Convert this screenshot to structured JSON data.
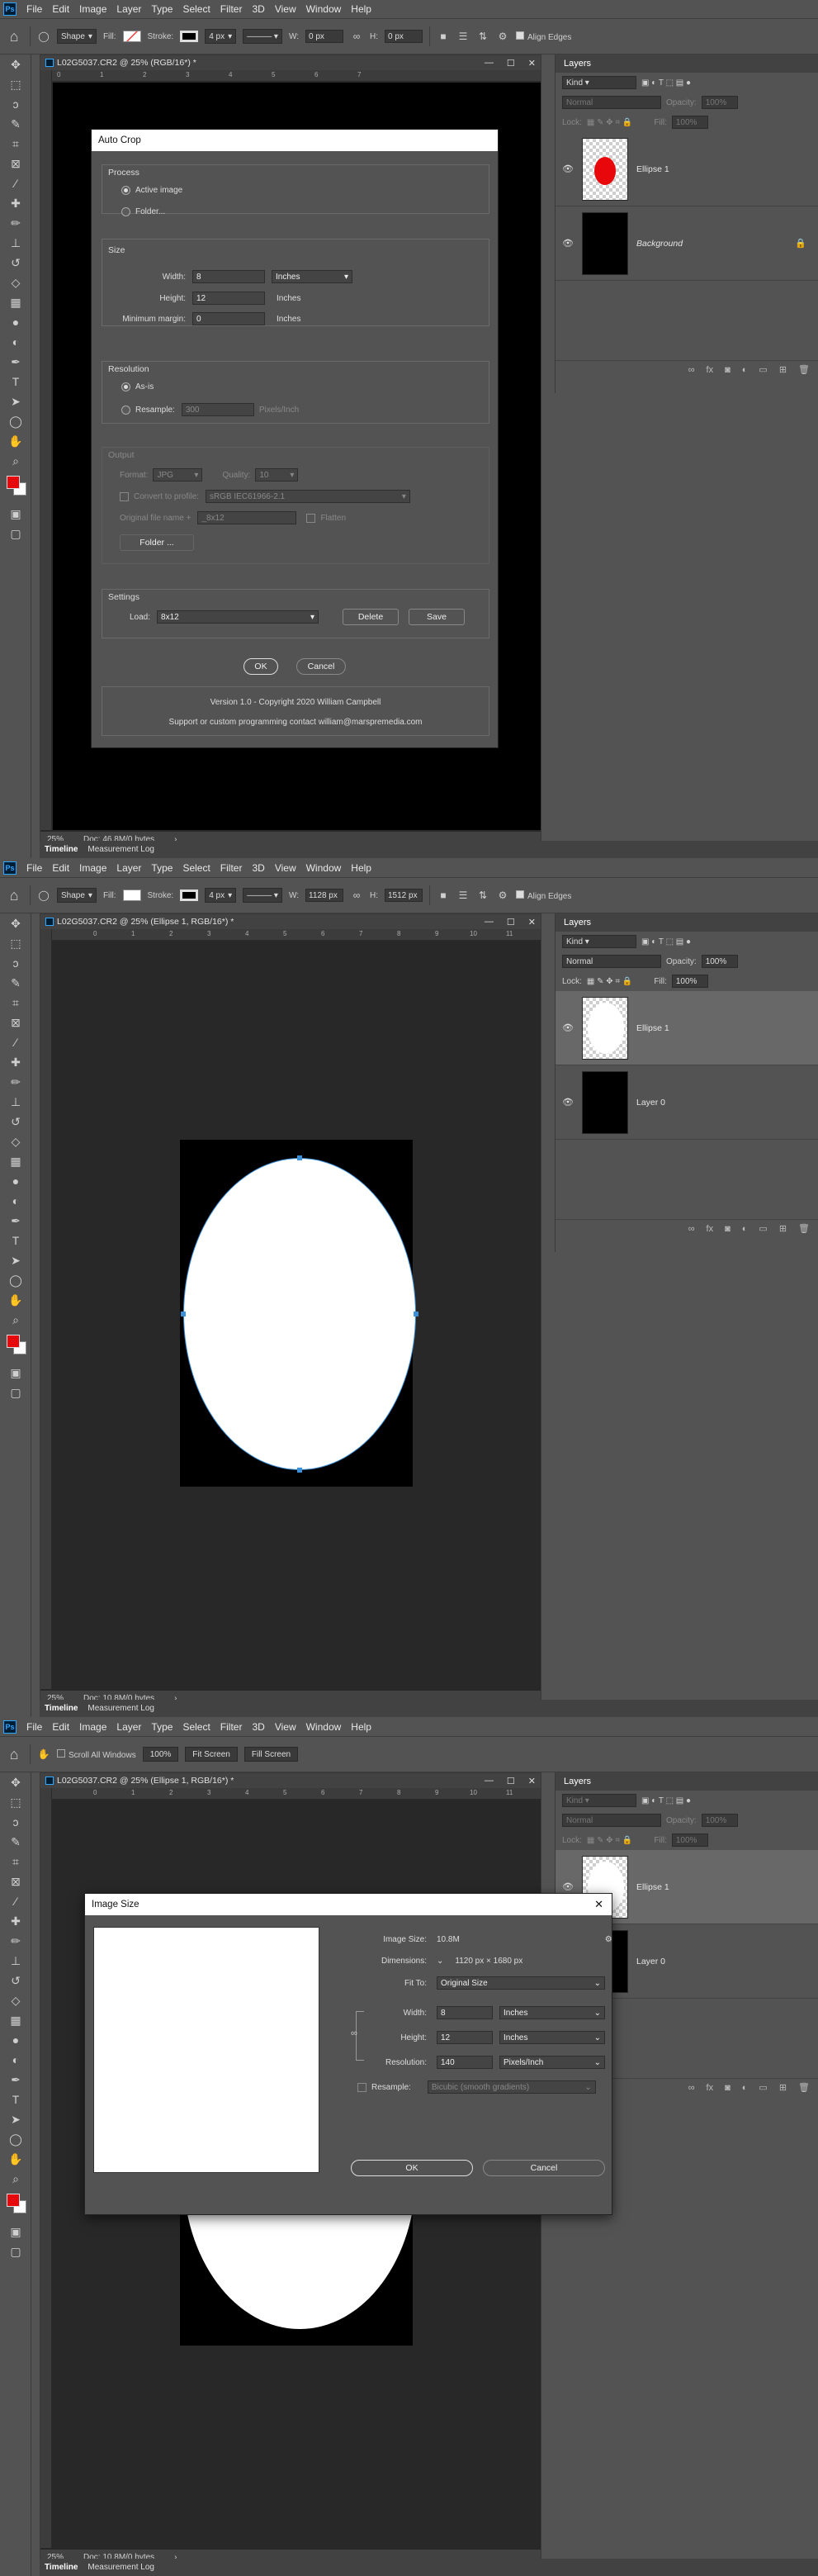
{
  "menus": [
    "File",
    "Edit",
    "Image",
    "Layer",
    "Type",
    "Select",
    "Filter",
    "3D",
    "View",
    "Window",
    "Help"
  ],
  "ps_logo": "Ps",
  "shot1": {
    "options": {
      "mode": "Shape",
      "fill_label": "Fill:",
      "stroke_label": "Stroke:",
      "stroke_width": "4 px",
      "w_label": "W:",
      "w_value": "0 px",
      "h_label": "H:",
      "h_value": "0 px",
      "align_edges": "Align Edges"
    },
    "doc_title": "L02G5037.CR2 @ 25% (RGB/16*) *",
    "ruler_h": [
      "0",
      "1",
      "2",
      "3",
      "4",
      "5",
      "6",
      "7"
    ],
    "status_zoom": "25%",
    "status_doc": "Doc: 46.8M/0 bytes",
    "dialog": {
      "title": "Auto Crop",
      "process": {
        "label": "Process",
        "active_image": "Active image",
        "folder": "Folder..."
      },
      "size": {
        "label": "Size",
        "width_label": "Width:",
        "width_value": "8",
        "width_unit": "Inches",
        "height_label": "Height:",
        "height_value": "12",
        "height_unit": "Inches",
        "margin_label": "Minimum margin:",
        "margin_value": "0",
        "margin_unit": "Inches"
      },
      "resolution": {
        "label": "Resolution",
        "as_is": "As-is",
        "resample": "Resample:",
        "resample_value": "300",
        "resample_unit": "Pixels/Inch"
      },
      "output": {
        "label": "Output",
        "format_label": "Format:",
        "format_value": "JPG",
        "quality_label": "Quality:",
        "quality_value": "10",
        "convert": "Convert to profile:",
        "profile_value": "sRGB IEC61966-2.1",
        "orig_label": "Original file name +",
        "orig_value": "_8x12",
        "flatten": "Flatten",
        "folder_btn": "Folder ..."
      },
      "settings": {
        "label": "Settings",
        "load_label": "Load:",
        "load_value": "8x12",
        "delete": "Delete",
        "save": "Save"
      },
      "ok": "OK",
      "cancel": "Cancel",
      "version": "Version 1.0 - Copyright 2020 William Campbell",
      "support": "Support or custom programming contact william@marspremedia.com"
    },
    "layers": [
      {
        "name": "Ellipse 1",
        "italic": false
      },
      {
        "name": "Background",
        "italic": true
      }
    ]
  },
  "shot2": {
    "options": {
      "mode": "Shape",
      "fill_label": "Fill:",
      "stroke_label": "Stroke:",
      "stroke_width": "4 px",
      "w_label": "W:",
      "w_value": "1128 px",
      "h_label": "H:",
      "h_value": "1512 px",
      "align_edges": "Align Edges"
    },
    "doc_title": "L02G5037.CR2 @ 25% (Ellipse 1, RGB/16*) *",
    "ruler_h": [
      "0",
      "1",
      "2",
      "3",
      "4",
      "5",
      "6",
      "7",
      "8",
      "9",
      "10",
      "11"
    ],
    "status_zoom": "25%",
    "status_doc": "Doc: 10.8M/0 bytes",
    "layers": [
      {
        "name": "Ellipse 1",
        "italic": false
      },
      {
        "name": "Layer 0",
        "italic": false
      }
    ]
  },
  "shot3": {
    "options": {
      "scroll_all": "Scroll All Windows",
      "zoom": "100%",
      "fit_screen": "Fit Screen",
      "fill_screen": "Fill Screen"
    },
    "doc_title": "L02G5037.CR2 @ 25% (Ellipse 1, RGB/16*) *",
    "ruler_h": [
      "0",
      "1",
      "2",
      "3",
      "4",
      "5",
      "6",
      "7",
      "8",
      "9",
      "10",
      "11"
    ],
    "status_zoom": "25%",
    "status_doc": "Doc: 10.8M/0 bytes",
    "dialog": {
      "title": "Image Size",
      "image_size_label": "Image Size:",
      "image_size_value": "10.8M",
      "dimensions_label": "Dimensions:",
      "dimensions_value": "1120 px  ×  1680 px",
      "fit_label": "Fit To:",
      "fit_value": "Original Size",
      "width_label": "Width:",
      "width_value": "8",
      "width_unit": "Inches",
      "height_label": "Height:",
      "height_value": "12",
      "height_unit": "Inches",
      "res_label": "Resolution:",
      "res_value": "140",
      "res_unit": "Pixels/Inch",
      "resample_label": "Resample:",
      "resample_value": "Bicubic (smooth gradients)",
      "ok": "OK",
      "cancel": "Cancel"
    },
    "layers": [
      {
        "name": "Ellipse 1",
        "italic": false
      },
      {
        "name": "Layer 0",
        "italic": false
      }
    ]
  },
  "layers_panel": {
    "title": "Layers",
    "kind": "Kind",
    "blend": "Normal",
    "opacity_label": "Opacity:",
    "opacity_value": "100%",
    "lock_label": "Lock:",
    "fill_label": "Fill:",
    "fill_value": "100%"
  },
  "bottom_tabs": [
    "Timeline",
    "Measurement Log"
  ],
  "colors": {
    "foreground": "#e8080b",
    "background": "#ffffff",
    "ellipse1_shot1": "#e8080b",
    "ellipse": "#ffffff",
    "anchor": "#3d8fd6"
  },
  "tools": [
    "move-icon",
    "marquee-icon",
    "lasso-icon",
    "quick-select-icon",
    "crop-icon",
    "frame-icon",
    "eyedropper-icon",
    "healing-icon",
    "brush-icon",
    "stamp-icon",
    "history-brush-icon",
    "eraser-icon",
    "gradient-icon",
    "blur-icon",
    "dodge-icon",
    "pen-icon",
    "type-icon",
    "path-select-icon",
    "ellipse-icon",
    "hand-icon",
    "zoom-icon"
  ]
}
